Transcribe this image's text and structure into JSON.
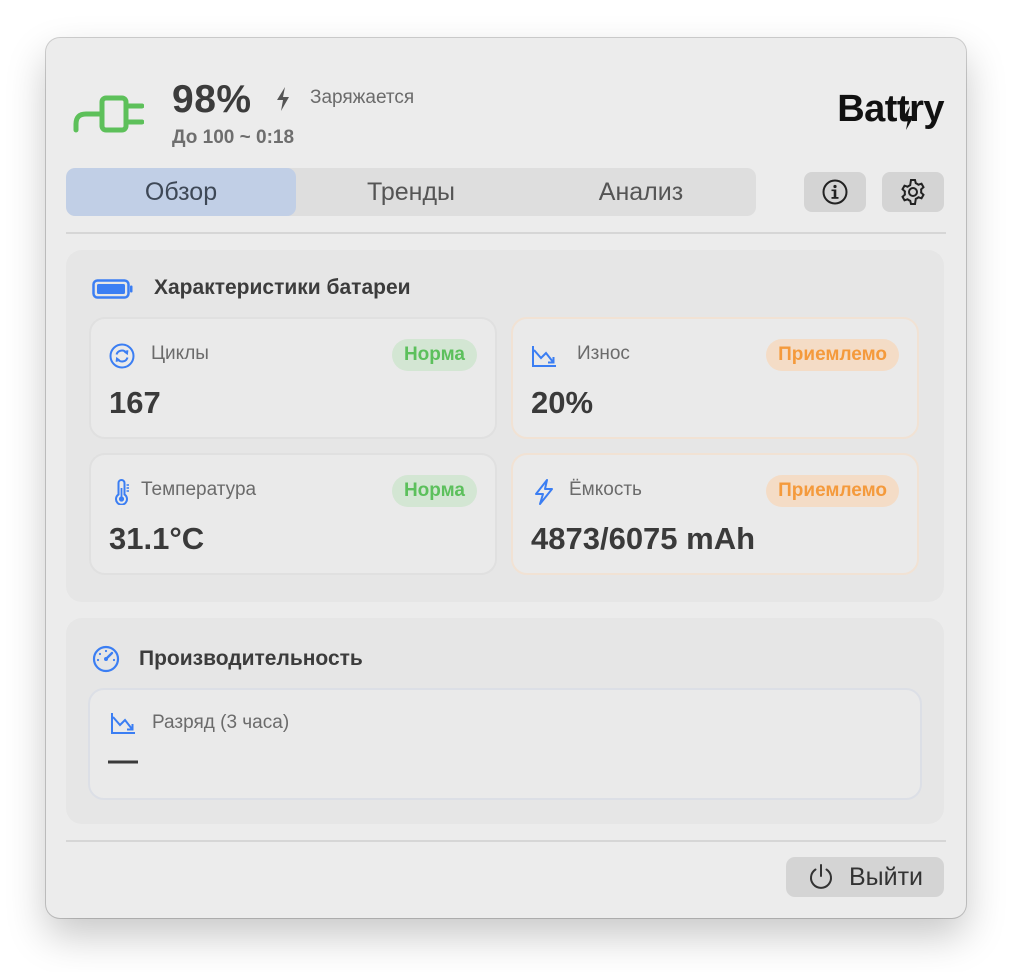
{
  "header": {
    "percent": "98%",
    "status": "Заряжается",
    "eta": "До 100 ~ 0:18",
    "logo_pre": "Bat",
    "logo_t": "t",
    "logo_post": "ry",
    "charging_icon": "plug-icon"
  },
  "tabs": [
    {
      "label": "Обзор",
      "active": true
    },
    {
      "label": "Тренды",
      "active": false
    },
    {
      "label": "Анализ",
      "active": false
    }
  ],
  "toolbar": {
    "info_icon": "info-icon",
    "settings_icon": "gear-icon"
  },
  "battery_section": {
    "title": "Характеристики батареи",
    "cards": [
      {
        "label": "Циклы",
        "value": "167",
        "badge": "Норма",
        "icon": "cycle-icon"
      },
      {
        "label": "Износ",
        "value": "20%",
        "badge": "Приемлемо",
        "icon": "chart-down-icon"
      },
      {
        "label": "Температура",
        "value": "31.1°C",
        "badge": "Норма",
        "icon": "thermometer-icon"
      },
      {
        "label": "Ёмкость",
        "value": "4873/6075 mAh",
        "badge": "Приемлемо",
        "icon": "bolt-icon"
      }
    ]
  },
  "performance_section": {
    "title": "Производительность",
    "card_label": "Разряд (3 часа)",
    "card_value": "—"
  },
  "footer": {
    "quit_label": "Выйти"
  },
  "colors": {
    "accent_blue": "#3b7ef3",
    "plug_green": "#5dc05a",
    "ok_green": "#5cc05c",
    "warn_orange": "#f49a3c",
    "active_tab": "#c1cfe6"
  }
}
